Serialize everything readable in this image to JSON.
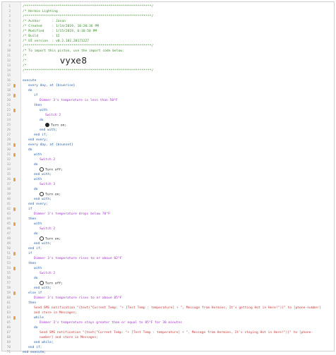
{
  "header": {
    "title": "/* Hermie Lighting",
    "author": "/* Author      : Jason",
    "created": "/* Created     : 1/14/2019, 10:20:36 PM",
    "modified": "/* Modified    : 1/15/2019, 6:10:58 PM",
    "build": "/* Build       : 12",
    "ui_version": "/* UI version  : v0.2.101.20171227",
    "import_text": "/* To import this piston, use the import code below:",
    "import_code": "vyxe8"
  },
  "code": {
    "execute": "execute",
    "every_day_sunrise": "every day, at {$sunrise}",
    "do": "do",
    "if": "if",
    "then": "then",
    "with": "with",
    "end_if": "end if;",
    "end_every": "end every;",
    "end_with": "end with;",
    "every_day_sunset": "every day, at {$sunset}",
    "switch2": "Switch 2",
    "switch3": "Switch 3",
    "turn_on": "Turn on;",
    "turn_off": "Turn off;",
    "dimmer_less_than_50": "Dimmer 3's temperature is less than 50°F",
    "dimmer_drops_below_70": "Dimmer 3's temperature drops below 70°F",
    "dimmer_rises_82": "Dimmer 3's temperature rises to or above 82°F",
    "else_if": "else if",
    "dimmer_rises_85": "Dimmer 3's temperature rises to or above 85°F",
    "sms1_a": "Send SMS notification \"{text(\"Current Temp: \"+ [Test Temp : temperature] + \", Message from Hermies, It's getting Hot in Here!\")}\" to [phone-number]",
    "sms1_b": "and store in Messages;",
    "while": "while",
    "dimmer_stays_85": "Dimmer 3's temperature stays greater than or equal to 85°F for 30 minutes",
    "sms2_a": "Send SMS notification \"{text(\"Current Temp: \"+ [Test Temp : temperature] + \", Message from Hermies, It's staying Hot in Here!\")}\" to [phone-",
    "sms2_b": "number] and store in Messages;",
    "end_while": "end while;",
    "end_execute": "end execute;"
  }
}
